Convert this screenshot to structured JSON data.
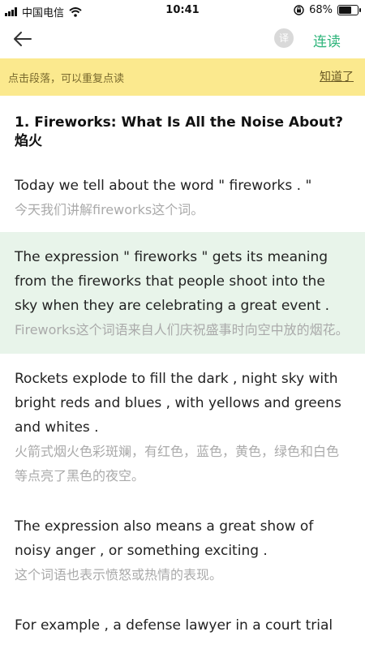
{
  "status": {
    "carrier": "中国电信",
    "time": "10:41",
    "battery_percent_label": "68%",
    "battery_level": 0.68
  },
  "nav": {
    "translate_label": "译",
    "continuous_read_label": "连读"
  },
  "tip": {
    "text": "点击段落，可以重复点读",
    "dismiss_label": "知道了"
  },
  "article": {
    "title_en": "1. Fireworks: What Is All the Noise About?",
    "title_zh": "焰火",
    "paragraphs": [
      {
        "en": "Today we tell about the word \" fireworks . \"",
        "zh": "今天我们讲解fireworks这个词。"
      },
      {
        "en": "The expression \" fireworks \" gets its meaning from the fireworks that people shoot into the sky when they are celebrating a great event .",
        "zh": "Fireworks这个词语来自人们庆祝盛事时向空中放的烟花。"
      },
      {
        "en": "Rockets explode to fill the dark , night sky with bright reds and blues , with yellows and greens and whites .",
        "zh": "火箭式烟火色彩斑斓，有红色，蓝色，黄色，绿色和白色等点亮了黑色的夜空。"
      },
      {
        "en": "The expression also means a great show of noisy anger , or something exciting .",
        "zh": "这个词语也表示愤怒或热情的表现。"
      },
      {
        "en": "For example , a defense lawyer in a court trial",
        "zh": ""
      }
    ]
  },
  "colors": {
    "accent": "#2db47a",
    "tip_background": "#fbe98e",
    "highlight_background": "#e8f4ea"
  }
}
